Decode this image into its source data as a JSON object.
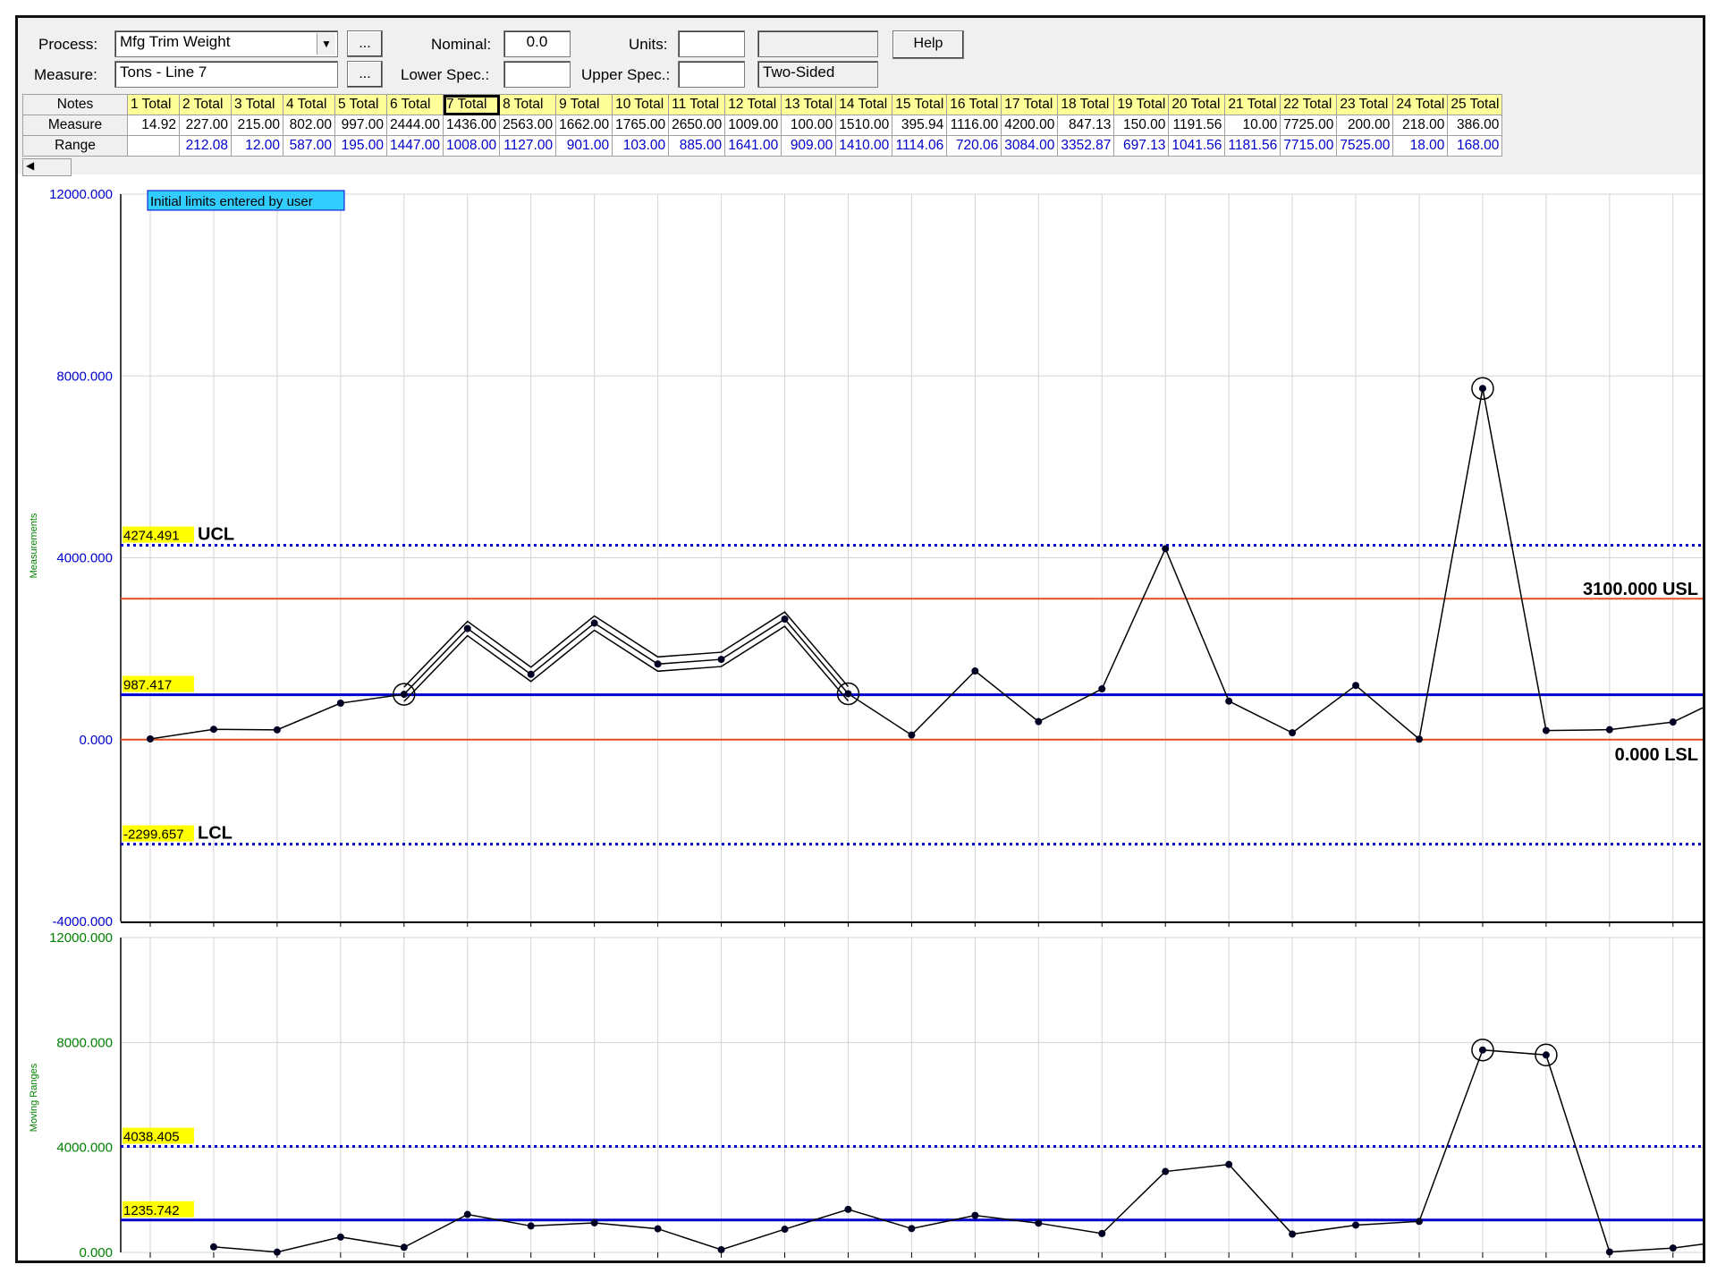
{
  "toolbar": {
    "process_label": "Process:",
    "process_value": "Mfg Trim Weight",
    "measure_label": "Measure:",
    "measure_value": "Tons - Line 7",
    "browse_label": "...",
    "nominal_label": "Nominal:",
    "nominal_value": "0.0",
    "lower_spec_label": "Lower Spec.:",
    "lower_spec_value": "",
    "units_label": "Units:",
    "units_value": "",
    "units_extra_value": "",
    "upper_spec_label": "Upper Spec.:",
    "upper_spec_value": "",
    "sided_value": "Two-Sided",
    "help_label": "Help"
  },
  "grid": {
    "row_headers": [
      "Notes",
      "Measure",
      "Range"
    ],
    "selected_column": 6,
    "columns": [
      "1 Total",
      "2 Total",
      "3 Total",
      "4 Total",
      "5 Total",
      "6 Total",
      "7 Total",
      "8 Total",
      "9 Total",
      "10 Total",
      "11 Total",
      "12 Total",
      "13 Total",
      "14 Total",
      "15 Total",
      "16 Total",
      "17 Total",
      "18 Total",
      "19 Total",
      "20 Total",
      "21 Total",
      "22 Total",
      "23 Total",
      "24 Total",
      "25 Total"
    ],
    "measure": [
      "14.92",
      "227.00",
      "215.00",
      "802.00",
      "997.00",
      "2444.00",
      "1436.00",
      "2563.00",
      "1662.00",
      "1765.00",
      "2650.00",
      "1009.00",
      "100.00",
      "1510.00",
      "395.94",
      "1116.00",
      "4200.00",
      "847.13",
      "150.00",
      "1191.56",
      "10.00",
      "7725.00",
      "200.00",
      "218.00",
      "386.00"
    ],
    "range": [
      "",
      "212.08",
      "12.00",
      "587.00",
      "195.00",
      "1447.00",
      "1008.00",
      "1127.00",
      "901.00",
      "103.00",
      "885.00",
      "1641.00",
      "909.00",
      "1410.00",
      "1114.06",
      "720.06",
      "3084.00",
      "3352.87",
      "697.13",
      "1041.56",
      "1181.56",
      "7715.00",
      "7525.00",
      "18.00",
      "168.00"
    ]
  },
  "chart_data": [
    {
      "type": "line",
      "ylabel": "Measurements",
      "ylim": [
        -4000,
        12000
      ],
      "yticks": [
        "12000.000",
        "8000.000",
        "4000.000",
        "0.000",
        "-4000.000"
      ],
      "note": "Initial limits entered by user",
      "values": [
        14.92,
        227,
        215,
        802,
        997,
        2444,
        1436,
        2563,
        1662,
        1765,
        2650,
        1009,
        100,
        1510,
        395.94,
        1116,
        4200,
        847.13,
        150,
        1191.56,
        10,
        7725,
        200,
        218,
        386,
        700
      ],
      "circled": [
        4,
        11,
        21
      ],
      "highlight_run": [
        4,
        11
      ],
      "ucl": {
        "value": 4274.491,
        "label": "4274.491",
        "name": "UCL"
      },
      "center": {
        "value": 987.417,
        "label": "987.417"
      },
      "lcl": {
        "value": -2299.657,
        "label": "-2299.657",
        "name": "LCL"
      },
      "usl": {
        "value": 3100,
        "label": "3100.000 USL"
      },
      "lsl": {
        "value": 0,
        "label": "0.000 LSL"
      },
      "colors": {
        "series": "#000000",
        "limit": "#0000cc",
        "spec": "#e05020",
        "tick": "#0000cc"
      }
    },
    {
      "type": "line",
      "ylabel": "Moving Ranges",
      "ylim": [
        0,
        12000
      ],
      "yticks": [
        "12000.000",
        "8000.000",
        "4000.000",
        "0.000"
      ],
      "values": [
        null,
        212.08,
        12,
        587,
        195,
        1447,
        1008,
        1127,
        901,
        103,
        885,
        1641,
        909,
        1410,
        1114.06,
        720.06,
        3084,
        3352.87,
        697.13,
        1041.56,
        1181.56,
        7715,
        7525,
        18,
        168,
        314
      ],
      "circled": [
        21,
        22
      ],
      "ucl": {
        "value": 4038.405,
        "label": "4038.405"
      },
      "center": {
        "value": 1235.742,
        "label": "1235.742"
      },
      "colors": {
        "series": "#000000",
        "limit": "#0000cc",
        "tick": "#008000"
      }
    }
  ]
}
